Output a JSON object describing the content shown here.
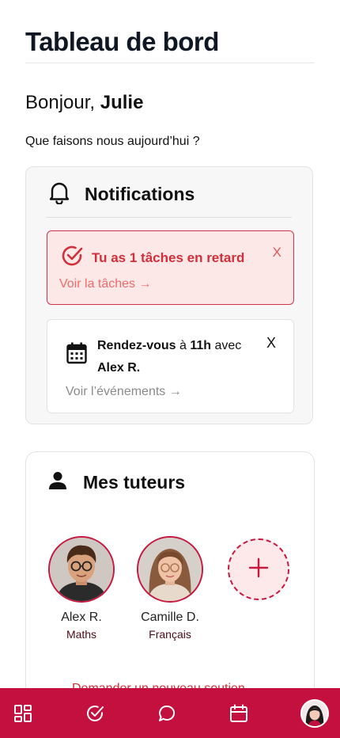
{
  "page": {
    "title": "Tableau de bord"
  },
  "greeting": {
    "prefix": "Bonjour, ",
    "name": "Julie",
    "subtitle": "Que faisons nous aujourd’hui ?"
  },
  "notifications": {
    "title": "Notifications",
    "overdue": {
      "text": "Tu as 1 tâches en retard",
      "link": "Voir la tâches →",
      "close": "X"
    },
    "appointment": {
      "label": "Rendez-vous",
      "at": " à ",
      "time": "11h",
      "with": " avec ",
      "person": "Alex R.",
      "link": "Voir l’événements →",
      "close": "X"
    }
  },
  "tutors": {
    "title": "Mes tuteurs",
    "items": [
      {
        "name": "Alex R.",
        "subject": "Maths"
      },
      {
        "name": "Camille D.",
        "subject": "Français"
      }
    ],
    "request_link": "Demander un nouveau soutien →"
  },
  "nav": {
    "items": [
      "dashboard-grid-icon",
      "check-circle-icon",
      "chat-bubble-icon",
      "calendar-icon",
      "profile-avatar"
    ]
  },
  "colors": {
    "brand": "#c4103f",
    "alert": "#d12f3a",
    "alert_bg": "#fde8e8"
  }
}
